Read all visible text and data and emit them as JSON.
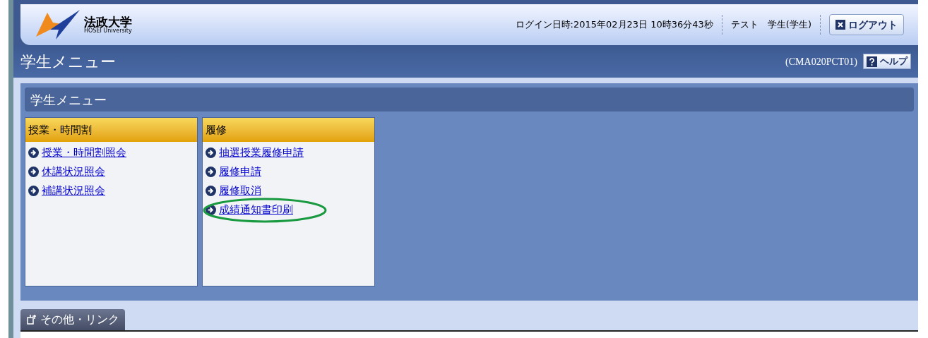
{
  "header": {
    "logo_name": "法政大学",
    "logo_sub": "HOSEI University",
    "login_time": "ログイン日時:2015年02月23日 10時36分43秒",
    "user": "テスト　学生(学生)",
    "logout": "ログアウト"
  },
  "title_bar": {
    "title": "学生メニュー",
    "screen_id": "(CMA020PCT01)",
    "help": "ヘルプ"
  },
  "menu": {
    "title": "学生メニュー",
    "groups": [
      {
        "title": "授業・時間割",
        "links": [
          {
            "label": "授業・時間割照会",
            "highlighted": false
          },
          {
            "label": "休講状況照会",
            "highlighted": false
          },
          {
            "label": "補講状況照会",
            "highlighted": false
          }
        ]
      },
      {
        "title": "履修",
        "links": [
          {
            "label": "抽選授業履修申請",
            "highlighted": false
          },
          {
            "label": "履修申請",
            "highlighted": false
          },
          {
            "label": "履修取消",
            "highlighted": false
          },
          {
            "label": "成績通知書印刷",
            "highlighted": true
          }
        ]
      }
    ]
  },
  "other_tab": {
    "title": "その他・リンク"
  }
}
